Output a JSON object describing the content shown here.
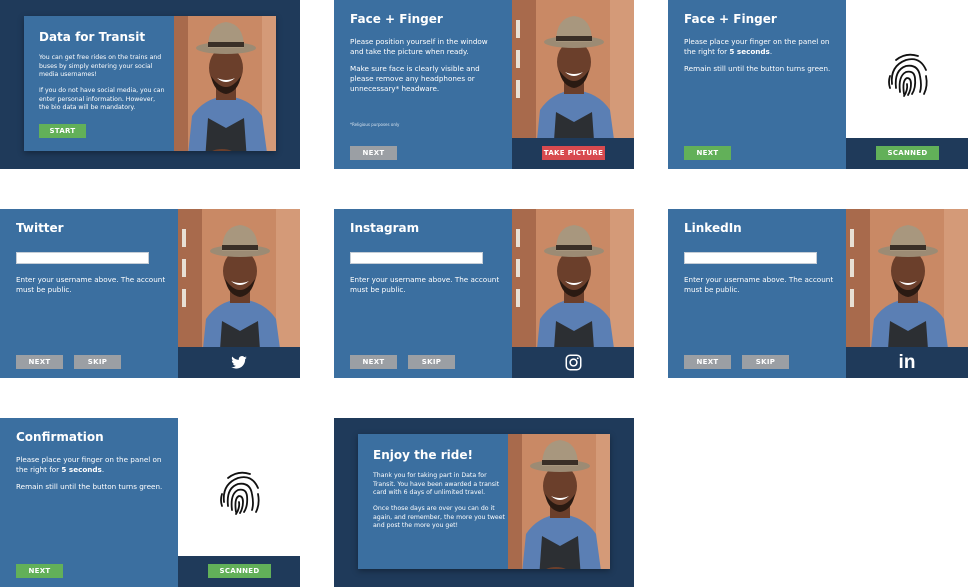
{
  "colors": {
    "panel": "#3b6fa0",
    "dark": "#1f3a5a",
    "green": "#62b059",
    "grey": "#9b9fa4",
    "red": "#d84a4f"
  },
  "welcome": {
    "title": "Data for Transit",
    "p1": "You can get free rides on the trains and buses by simply entering your social media usernames!",
    "p2": "If you do not have social media, you can enter personal information. However, the bio data will be mandatory.",
    "start": "START"
  },
  "face": {
    "title": "Face + Finger",
    "p1": "Please position yourself in the window and take the picture when ready.",
    "p2": "Make sure face is clearly visible and please remove any headphones or unnecessary* headware.",
    "note": "*Religious purposes only",
    "next": "NEXT",
    "take": "TAKE PICTURE"
  },
  "finger": {
    "title": "Face + Finger",
    "p1_a": "Please place your finger on the panel on the right for ",
    "p1_b": "5 seconds",
    "p1_c": ".",
    "p2": "Remain still until the button turns green.",
    "next": "NEXT",
    "scanned": "SCANNED"
  },
  "twitter": {
    "title": "Twitter",
    "hint": "Enter your username above. The account must be public.",
    "next": "NEXT",
    "skip": "SKIP"
  },
  "instagram": {
    "title": "Instagram",
    "hint": "Enter your username above. The account must be public.",
    "next": "NEXT",
    "skip": "SKIP"
  },
  "linkedin": {
    "title": "LinkedIn",
    "hint": "Enter your username above. The account must be public.",
    "next": "NEXT",
    "skip": "SKIP",
    "logo": "in"
  },
  "confirm": {
    "title": "Confirmation",
    "p1_a": "Please place your finger on the panel on the right for ",
    "p1_b": "5 seconds",
    "p1_c": ".",
    "p2": "Remain still until the button turns green.",
    "next": "NEXT",
    "scanned": "SCANNED"
  },
  "enjoy": {
    "title": "Enjoy the ride!",
    "p1": "Thank you for taking part in Data for Transit. You have been awarded a transit card with 6 days of unlimited travel.",
    "p2": "Once those days are over you can do it again, and remember, the more you tweet and post the more you get!"
  },
  "icons": [
    "fingerprint-icon",
    "twitter-icon",
    "instagram-icon",
    "linkedin-icon"
  ]
}
